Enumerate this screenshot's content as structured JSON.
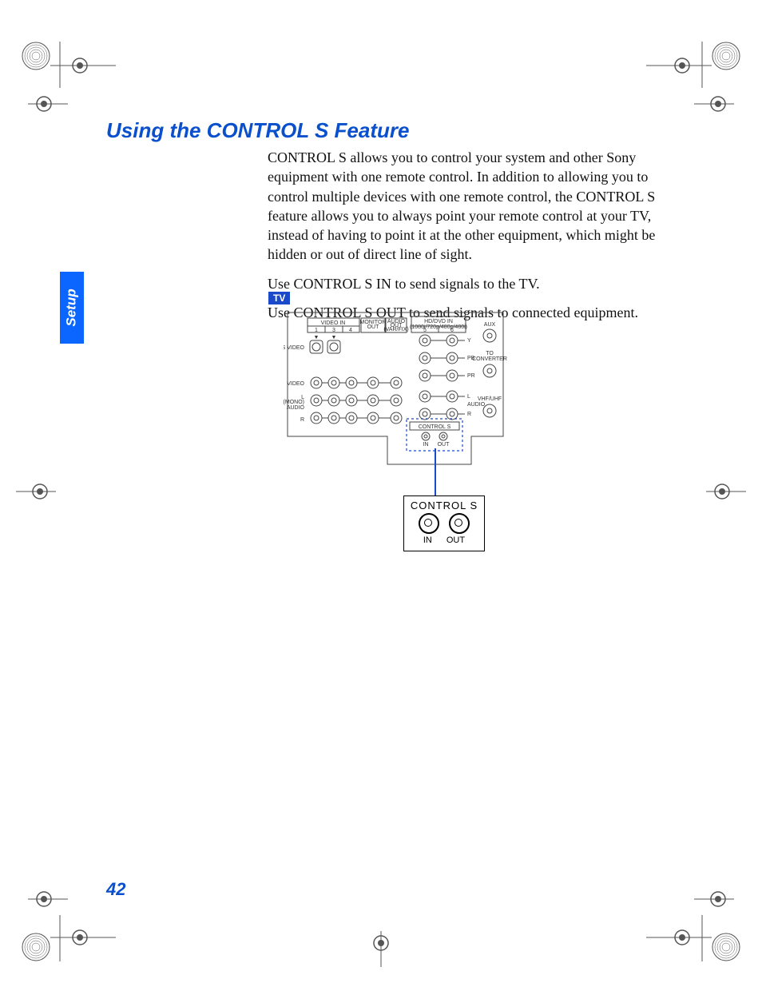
{
  "side_tab": "Setup",
  "title": "Using the CONTROL S Feature",
  "paragraphs": {
    "p1": "CONTROL S allows you to control your system and other Sony equipment with one remote control. In addition to allowing you to control multiple devices with one remote control, the CONTROL S feature allows you to always point your remote control at your TV, instead of having to point it at the other equipment, which might be hidden or out of direct line of sight.",
    "p2": "Use CONTROL S IN to send signals to the TV.",
    "p3": "Use CONTROL S OUT to send signals to connected equipment."
  },
  "badge": "TV",
  "diagram": {
    "video_in": "VIDEO IN",
    "cols": {
      "c1": "1",
      "c3": "3",
      "c4": "4",
      "c5": "5",
      "c6": "6"
    },
    "monitor_out": "MONITOR\nOUT",
    "audio_out": "AUDIO\nOUT",
    "audio_out_sub": "(VAR/FIX)",
    "hd_dvd": "HD/DVD IN",
    "hd_sub": "(1080i/720p/480p/480i)",
    "svideo": "S VIDEO",
    "video": "VIDEO",
    "l_mono": "L\n(MONO)",
    "audio_l": "AUDIO",
    "r": "R",
    "y": "Y",
    "pb": "PB",
    "pr": "PR",
    "audio_r_l": "L",
    "audio_r": "AUDIO",
    "audio_r_r": "R",
    "aux": "AUX",
    "to_conv": "TO\nCONVERTER",
    "vhf": "VHF/UHF",
    "control_s": "CONTROL S",
    "in": "IN",
    "out": "OUT"
  },
  "callout": {
    "title": "CONTROL S",
    "in": "IN",
    "out": "OUT"
  },
  "page_number": "42"
}
